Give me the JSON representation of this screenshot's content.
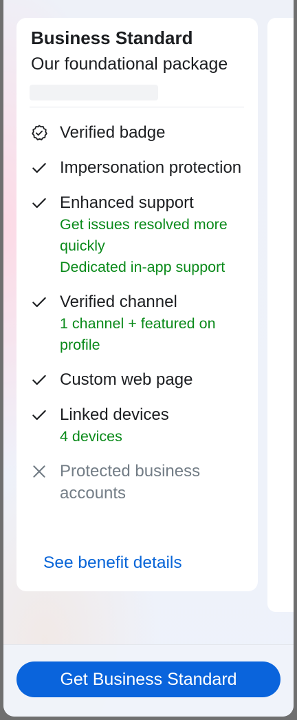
{
  "plan_card": {
    "title": "Business Standard",
    "subtitle": "Our foundational package",
    "features": [
      {
        "icon": "verified-badge-icon",
        "label": "Verified badge",
        "details": [],
        "included": true
      },
      {
        "icon": "check-icon",
        "label": "Impersonation protection",
        "details": [],
        "included": true
      },
      {
        "icon": "check-icon",
        "label": "Enhanced support",
        "details": [
          "Get issues resolved more quickly",
          "Dedicated in-app support"
        ],
        "included": true
      },
      {
        "icon": "check-icon",
        "label": "Verified channel",
        "details": [
          "1 channel + featured on profile"
        ],
        "included": true
      },
      {
        "icon": "check-icon",
        "label": "Custom web page",
        "details": [],
        "included": true
      },
      {
        "icon": "check-icon",
        "label": "Linked devices",
        "details": [
          "4 devices"
        ],
        "included": true
      },
      {
        "icon": "close-icon",
        "label": "Protected business accounts",
        "details": [],
        "included": false
      }
    ],
    "see_details_link": "See benefit details"
  },
  "footer": {
    "cta_label": "Get Business Standard"
  },
  "colors": {
    "accent": "#0a64dc",
    "link": "#0865d8",
    "positive": "#0a8a1a",
    "muted": "#737d86"
  }
}
